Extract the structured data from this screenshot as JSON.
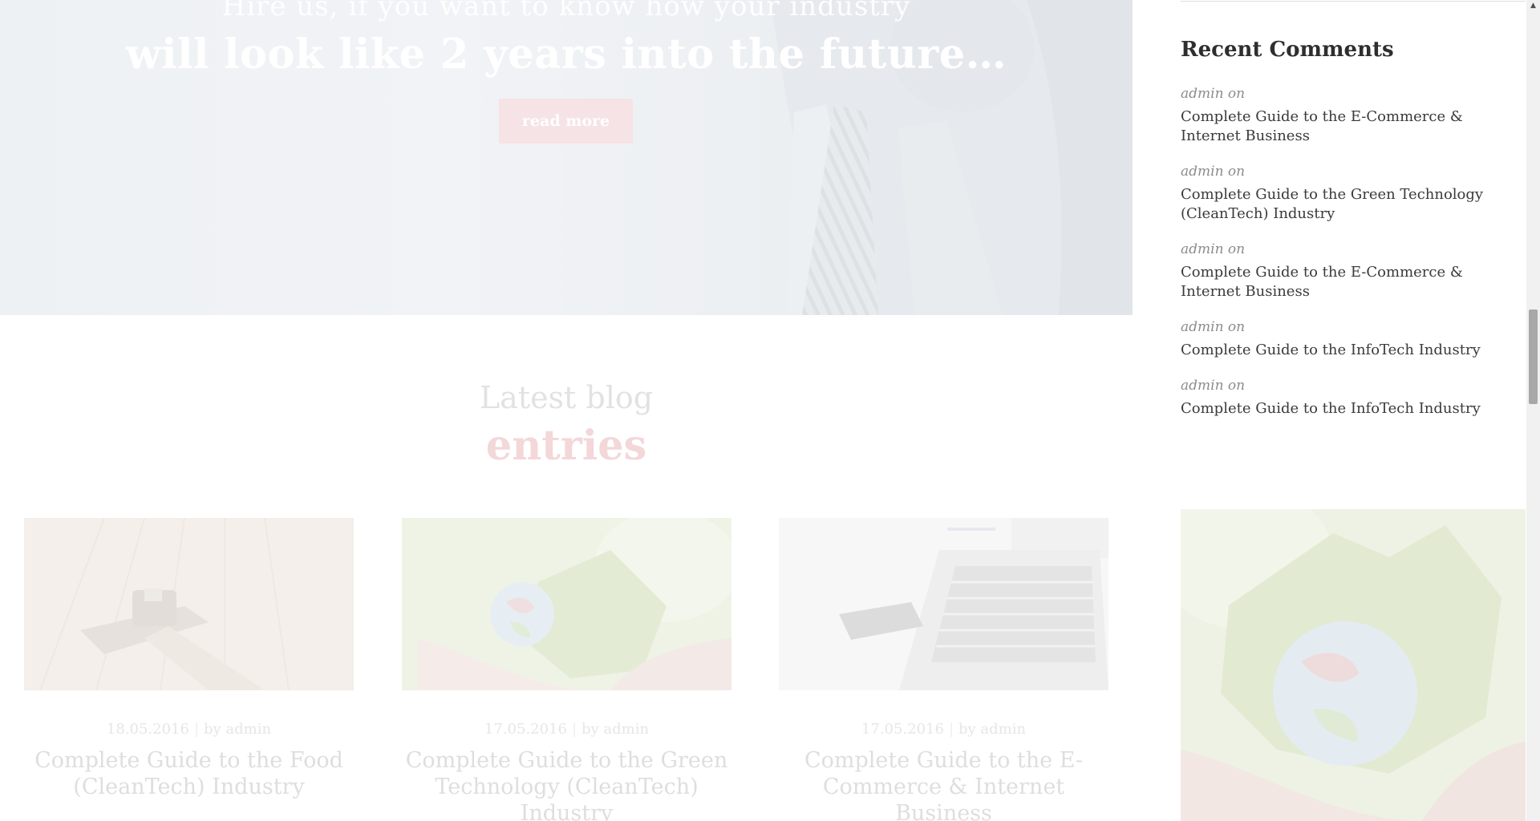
{
  "hero": {
    "line1": "Hire us, if you want to know how your industry",
    "line2": "will look like 2 years into the future…",
    "button_label": "read more"
  },
  "blog_section": {
    "title_line1": "Latest blog",
    "title_line2": "entries",
    "posts": [
      {
        "date": "18.05.2016",
        "separator": "|",
        "author": "by admin",
        "title": "Complete Guide to the Food (CleanTech) Industry",
        "image": "harvester-field-image"
      },
      {
        "date": "17.05.2016",
        "separator": "|",
        "author": "by admin",
        "title": "Complete Guide to the Green Technology (CleanTech) Industry",
        "image": "globe-in-hands-image"
      },
      {
        "date": "17.05.2016",
        "separator": "|",
        "author": "by admin",
        "title": "Complete Guide to the E-Commerce & Internet Business",
        "image": "laptop-card-image"
      }
    ]
  },
  "sidebar": {
    "recent_comments_title": "Recent Comments",
    "comments": [
      {
        "author": "admin on",
        "link": "Complete Guide to the E-Commerce & Internet Business"
      },
      {
        "author": "admin on",
        "link": "Complete Guide to the Green Technology (CleanTech) Industry"
      },
      {
        "author": "admin on",
        "link": "Complete Guide to the E-Commerce & Internet Business"
      },
      {
        "author": "admin on",
        "link": "Complete Guide to the InfoTech Industry"
      },
      {
        "author": "admin on",
        "link": "Complete Guide to the InfoTech Industry"
      }
    ],
    "image": "globe-in-hands-image"
  },
  "scrollbar": {
    "up_icon": "triangle-up-icon"
  },
  "colors": {
    "accent_pink": "#f3d7d9",
    "button_bg": "#f6e3e5"
  }
}
